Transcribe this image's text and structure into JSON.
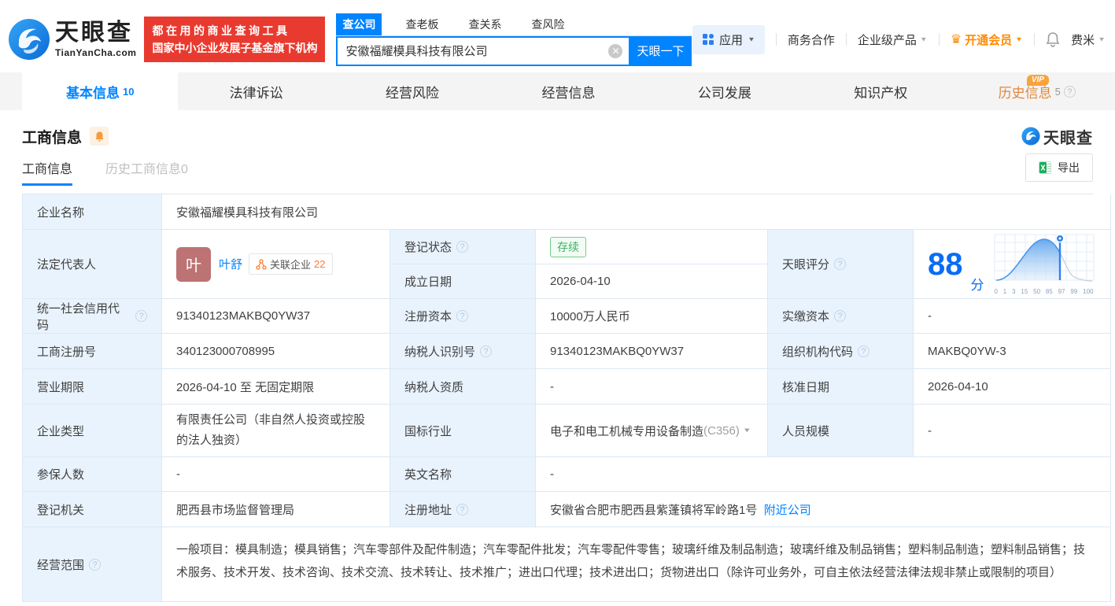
{
  "header": {
    "logo": {
      "title": "天眼查",
      "domain": "TianYanCha.com"
    },
    "slogan": {
      "line1": "都在用的商业查询工具",
      "line2": "国家中小企业发展子基金旗下机构"
    },
    "search": {
      "tabs": [
        {
          "label": "查公司"
        },
        {
          "label": "查老板"
        },
        {
          "label": "查关系"
        },
        {
          "label": "查风险"
        }
      ],
      "value": "安徽福耀模具科技有限公司",
      "button": "天眼一下"
    },
    "menu": {
      "app": "应用",
      "cooperation": "商务合作",
      "enterprise": "企业级产品",
      "vip": "开通会员",
      "user": "费米"
    }
  },
  "nav": {
    "tabs": [
      {
        "label": "基本信息",
        "count": "10"
      },
      {
        "label": "法律诉讼"
      },
      {
        "label": "经营风险"
      },
      {
        "label": "经营信息"
      },
      {
        "label": "公司发展"
      },
      {
        "label": "知识产权"
      },
      {
        "label": "历史信息",
        "count": "5",
        "vip": "VIP"
      }
    ]
  },
  "section": {
    "title": "工商信息",
    "watermark": "天眼查",
    "subtabs": [
      {
        "label": "工商信息"
      },
      {
        "label": "历史工商信息0"
      }
    ],
    "export_label": "导出"
  },
  "table": {
    "company_name_label": "企业名称",
    "company_name": "安徽福耀模具科技有限公司",
    "legal_rep_label": "法定代表人",
    "legal_rep_avatar": "叶",
    "legal_rep_name": "叶舒",
    "related_label": "关联企业",
    "related_count": "22",
    "reg_status_label": "登记状态",
    "reg_status": "存续",
    "est_date_label": "成立日期",
    "est_date": "2026-04-10",
    "score_label": "天眼评分",
    "score": "88",
    "score_unit": "分",
    "credit_code_label": "统一社会信用代码",
    "credit_code": "91340123MAKBQ0YW37",
    "reg_capital_label": "注册资本",
    "reg_capital": "10000万人民币",
    "paid_capital_label": "实缴资本",
    "paid_capital": "-",
    "reg_number_label": "工商注册号",
    "reg_number": "340123000708995",
    "taxpayer_id_label": "纳税人识别号",
    "taxpayer_id": "91340123MAKBQ0YW37",
    "org_code_label": "组织机构代码",
    "org_code": "MAKBQ0YW-3",
    "term_label": "营业期限",
    "term": "2026-04-10 至 无固定期限",
    "taxpayer_quality_label": "纳税人资质",
    "taxpayer_quality": "-",
    "approval_date_label": "核准日期",
    "approval_date": "2026-04-10",
    "company_type_label": "企业类型",
    "company_type": "有限责任公司（非自然人投资或控股的法人独资）",
    "industry_label": "国标行业",
    "industry": "电子和电工机械专用设备制造",
    "industry_code": "(C356)",
    "staff_size_label": "人员规模",
    "staff_size": "-",
    "insured_label": "参保人数",
    "insured": "-",
    "english_name_label": "英文名称",
    "english_name": "-",
    "reg_authority_label": "登记机关",
    "reg_authority": "肥西县市场监督管理局",
    "address_label": "注册地址",
    "address": "安徽省合肥市肥西县紫蓬镇将军岭路1号",
    "nearby_link": "附近公司",
    "scope_label": "经营范围",
    "scope": "一般项目：模具制造；模具销售；汽车零部件及配件制造；汽车零配件批发；汽车零配件零售；玻璃纤维及制品制造；玻璃纤维及制品销售；塑料制品制造；塑料制品销售；技术服务、技术开发、技术咨询、技术交流、技术转让、技术推广；进出口代理；技术进出口；货物进出口（除许可业务外，可自主依法经营法律法规非禁止或限制的项目）"
  },
  "score_chart": {
    "type": "area",
    "ticks": [
      "0",
      "1",
      "3",
      "15",
      "50",
      "85",
      "97",
      "99",
      "100"
    ],
    "score_marker": 88
  },
  "colors": {
    "brand_blue": "#0084ff",
    "score_blue": "#0a6cf5",
    "vip_orange": "#ff8a00",
    "history_orange": "#e0883c",
    "slogan_red": "#e93a2f",
    "status_green": "#3cb45f",
    "label_bg": "#e9f3fd",
    "table_border": "#dce8f2",
    "avatar_bg": "#bd7373"
  }
}
